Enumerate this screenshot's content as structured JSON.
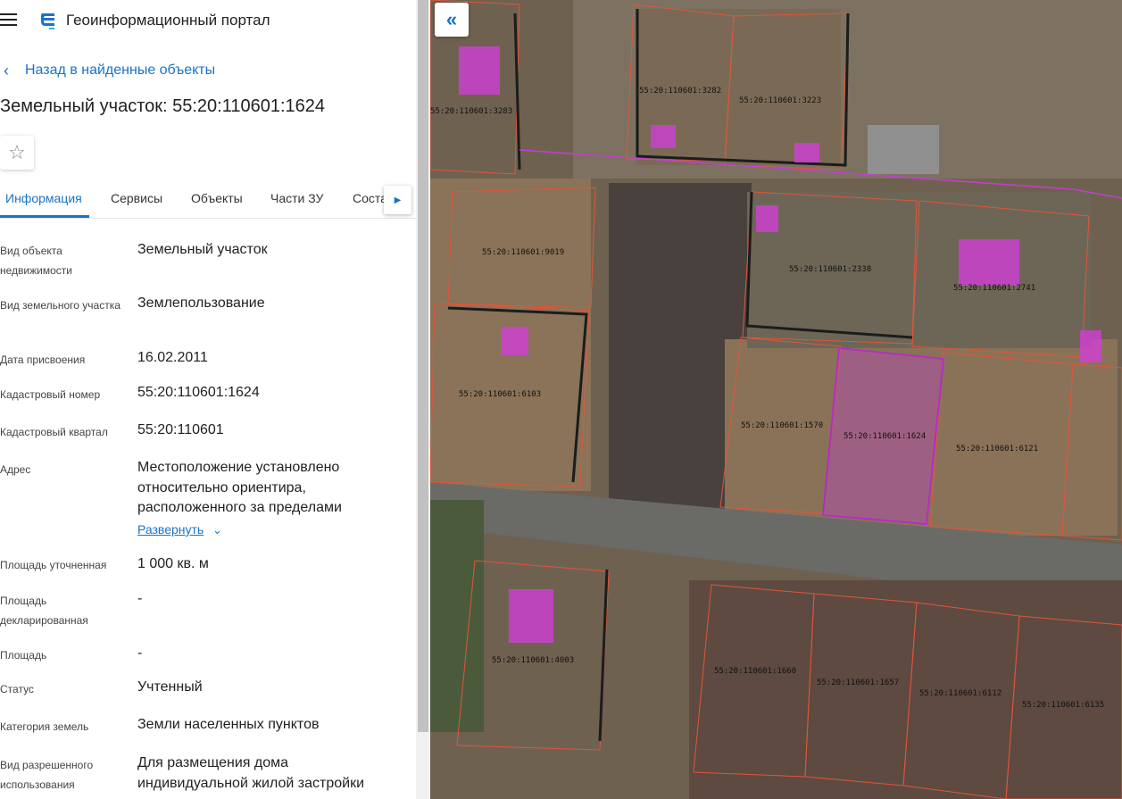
{
  "header": {
    "portal_title": "Геоинформационный портал"
  },
  "back_link": "Назад в найденные объекты",
  "page_title": "Земельный участок: 55:20:110601:1624",
  "tabs": [
    {
      "label": "Информация",
      "active": true
    },
    {
      "label": "Сервисы",
      "active": false
    },
    {
      "label": "Объекты",
      "active": false
    },
    {
      "label": "Части ЗУ",
      "active": false
    },
    {
      "label": "Состав",
      "active": false
    }
  ],
  "properties": [
    {
      "label": "Вид объекта недвижимости",
      "value": "Земельный участок"
    },
    {
      "label": "Вид земельного участка",
      "value": "Землепользование"
    },
    {
      "label": "Дата присвоения",
      "value": "16.02.2011"
    },
    {
      "label": "Кадастровый номер",
      "value": "55:20:110601:1624"
    },
    {
      "label": "Кадастровый квартал",
      "value": "55:20:110601"
    },
    {
      "label": "Адрес",
      "value": "Местоположение установлено относительно ориентира, расположенного за пределами"
    },
    {
      "label": "Площадь уточненная",
      "value": "1 000 кв. м"
    },
    {
      "label": "Площадь декларированная",
      "value": "-"
    },
    {
      "label": "Площадь",
      "value": "-"
    },
    {
      "label": "Статус",
      "value": "Учтенный"
    },
    {
      "label": "Категория земель",
      "value": "Земли населенных пунктов"
    },
    {
      "label": "Вид разрешенного использования",
      "value": "Для размещения дома индивидуальной жилой застройки"
    }
  ],
  "expand_label": "Развернуть",
  "map": {
    "parcel_labels": [
      "55:20:110601:3282",
      "55:20:110601:3223",
      "55:20:110601:3283",
      "55:20:110601:9019",
      "55:20:110601:2338",
      "55:20:110601:2741",
      "55:20:110601:6103",
      "55:20:110601:1570",
      "55:20:110601:1624",
      "55:20:110601:6121",
      "55:20:110601:4003",
      "55:20:110601:1660",
      "55:20:110601:1657",
      "55:20:110601:6112",
      "55:20:110601:6135"
    ],
    "colors": {
      "boundary": "#e0563a",
      "selected": "#b42fc0",
      "building": "#d13fd6",
      "accent": "#1a73c8"
    }
  },
  "icons": {
    "menu": "hamburger-icon",
    "logo": "portal-logo-icon",
    "back": "chevron-left-icon",
    "favorite": "star-icon",
    "tabs_next": "chevron-right-icon",
    "expand": "chevron-down-icon",
    "collapse": "double-chevron-left-icon"
  }
}
